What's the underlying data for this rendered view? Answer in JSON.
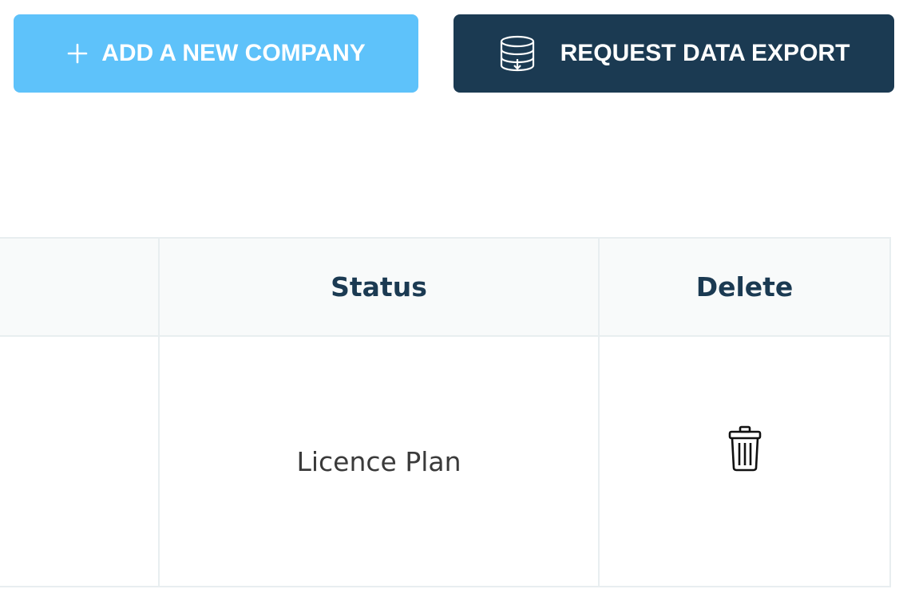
{
  "toolbar": {
    "add_company_label": "ADD A NEW COMPANY",
    "add_company_icon": "plus-icon",
    "export_label": "REQUEST DATA EXPORT",
    "export_icon": "database-export-icon"
  },
  "table": {
    "columns": [
      {
        "label": ""
      },
      {
        "label": "Status"
      },
      {
        "label": "Delete"
      }
    ],
    "rows": [
      {
        "col1": "",
        "status": "Licence Plan",
        "delete_icon": "trash-icon"
      }
    ]
  },
  "colors": {
    "add_button": "#5ec2fa",
    "export_button": "#1b3a52",
    "header_text": "#1b3a52",
    "header_bg": "#f8fafa",
    "border": "#e8eef0"
  }
}
